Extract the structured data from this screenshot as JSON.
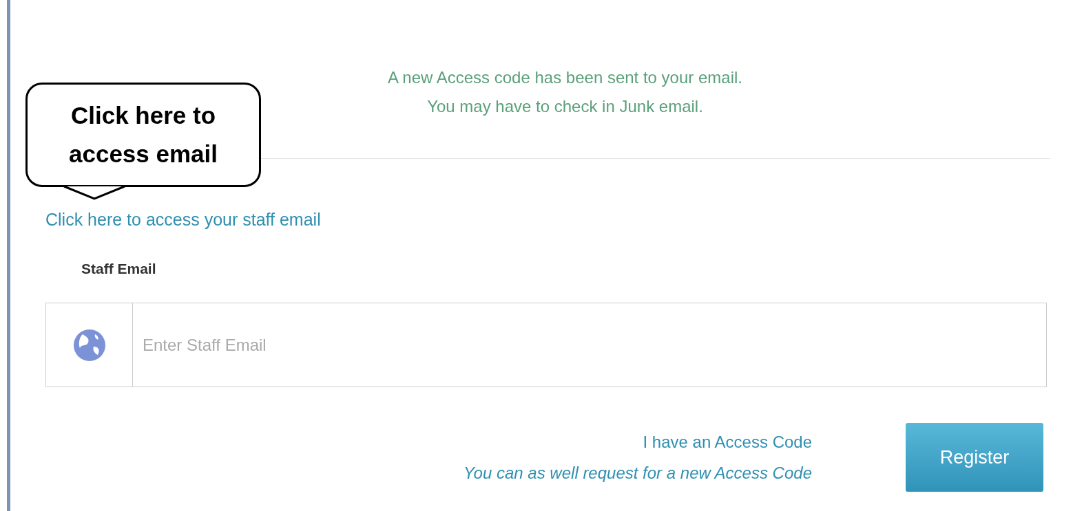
{
  "message": {
    "lines": [
      "A new Access code has been sent to your email.",
      "You may have to check in Junk email."
    ]
  },
  "callout": {
    "text": "Click here to access email"
  },
  "staff_email_link": "Click here to access your staff email",
  "staff_email": {
    "label": "Staff Email",
    "placeholder": "Enter Staff Email"
  },
  "links": [
    {
      "text": "I have an Access Code",
      "italic": false
    },
    {
      "text": "You can as well request for a new Access Code",
      "italic": true
    }
  ],
  "register_button": "Register"
}
